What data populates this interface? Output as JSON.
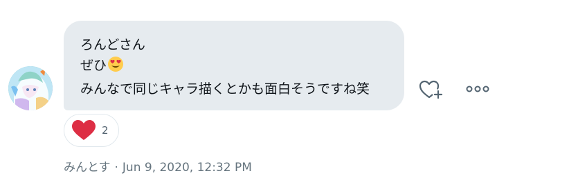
{
  "message": {
    "lines": [
      "ろんどさん",
      "ぜひ",
      "みんなで同じキャラ描くとかも面白そうですね笑"
    ],
    "emoji": "smiling-face-with-heart-eyes-icon",
    "bubble_color": "#e6ebef"
  },
  "reactions": [
    {
      "icon": "red-heart-icon",
      "count": "2",
      "color": "#e0245e"
    }
  ],
  "actions": {
    "add_reaction_icon": "heart-plus-icon",
    "more_icon": "more-horizontal-icon"
  },
  "meta": {
    "sender": "みんとす",
    "separator": "·",
    "timestamp": "Jun 9, 2020, 12:32 PM"
  }
}
